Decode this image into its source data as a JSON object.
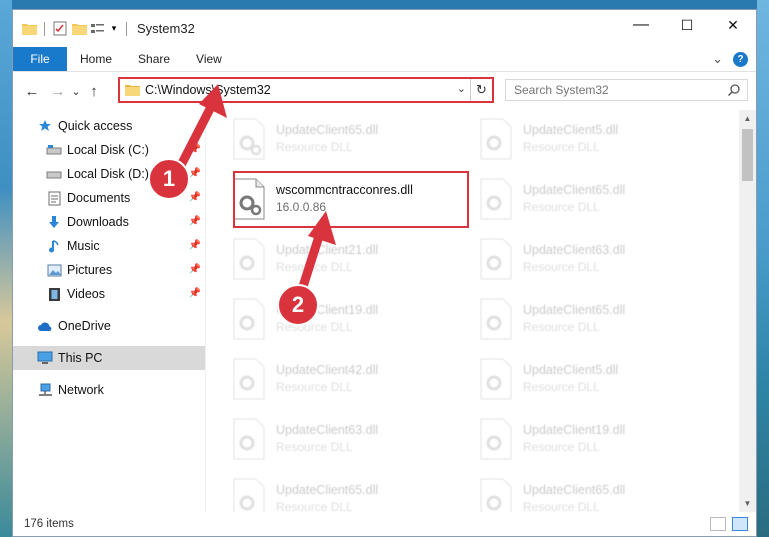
{
  "window": {
    "title": "System32",
    "qat_icons": [
      "folder-icon",
      "properties-icon",
      "new-folder-icon",
      "customize-icon"
    ],
    "controls": {
      "minimize": "—",
      "maximize": "☐",
      "close": "✕"
    }
  },
  "ribbon": {
    "tabs": [
      "File",
      "Home",
      "Share",
      "View"
    ],
    "expand_glyph": "⌄",
    "help_glyph": "?"
  },
  "navbar": {
    "back": "←",
    "forward": "→",
    "recent": "⌄",
    "up": "↑",
    "address": "C:\\Windows\\System32",
    "address_dropdown": "⌄",
    "refresh": "↻",
    "search_placeholder": "Search System32"
  },
  "sidebar": {
    "items": [
      {
        "label": "Quick access",
        "pinned": false
      },
      {
        "label": "Local Disk (C:)",
        "pinned": true
      },
      {
        "label": "Local Disk (D:)",
        "pinned": true
      },
      {
        "label": "Documents",
        "pinned": true
      },
      {
        "label": "Downloads",
        "pinned": true
      },
      {
        "label": "Music",
        "pinned": true
      },
      {
        "label": "Pictures",
        "pinned": true
      },
      {
        "label": "Videos",
        "pinned": true
      },
      {
        "label": "OneDrive",
        "pinned": false
      },
      {
        "label": "This PC",
        "pinned": false,
        "selected": true
      },
      {
        "label": "Network",
        "pinned": false
      }
    ]
  },
  "files": {
    "highlighted": {
      "name": "wscommcntracconres.dll",
      "version": "16.0.0.86"
    },
    "left_column": [
      {
        "name": "UpdateClient65.dll",
        "desc": "Resource DLL"
      },
      {
        "name": "UpdateClient21.dll",
        "desc": "Resource DLL"
      },
      {
        "name": "UpdateClient19.dll",
        "desc": "Resource DLL"
      },
      {
        "name": "UpdateClient42.dll",
        "desc": "Resource DLL"
      },
      {
        "name": "UpdateClient63.dll",
        "desc": "Resource DLL"
      },
      {
        "name": "UpdateClient65.dll",
        "desc": "Resource DLL"
      }
    ],
    "right_column": [
      {
        "name": "UpdateClient5.dll",
        "desc": "Resource DLL"
      },
      {
        "name": "UpdateClient65.dll",
        "desc": "Resource DLL"
      },
      {
        "name": "UpdateClient63.dll",
        "desc": "Resource DLL"
      },
      {
        "name": "UpdateClient65.dll",
        "desc": "Resource DLL"
      },
      {
        "name": "UpdateClient5.dll",
        "desc": "Resource DLL"
      },
      {
        "name": "UpdateClient19.dll",
        "desc": "Resource DLL"
      },
      {
        "name": "UpdateClient65.dll",
        "desc": "Resource DLL"
      }
    ]
  },
  "status": {
    "item_count": "176 items"
  },
  "annotations": {
    "step1": "1",
    "step2": "2",
    "color": "#d9343d"
  }
}
